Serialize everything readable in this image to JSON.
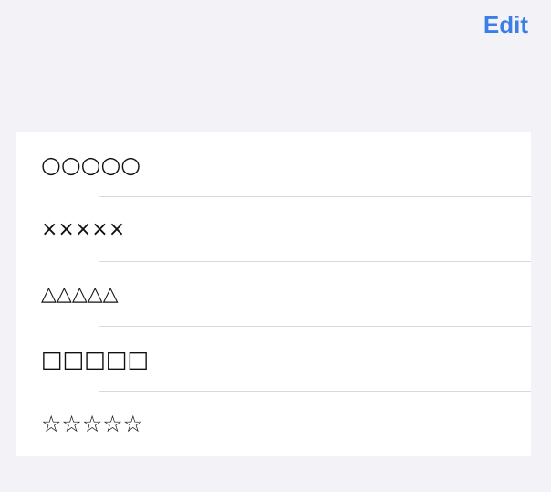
{
  "header": {
    "edit_label": "Edit"
  },
  "list": {
    "items": [
      {
        "label": "○○○○○"
      },
      {
        "label": "×××××"
      },
      {
        "label": "△△△△△"
      },
      {
        "label": "□□□□□"
      },
      {
        "label": "☆☆☆☆☆"
      }
    ]
  },
  "colors": {
    "background": "#f2f2f7",
    "accent": "#3a7ee6",
    "separator": "#d9d9dd",
    "cell": "#ffffff"
  }
}
